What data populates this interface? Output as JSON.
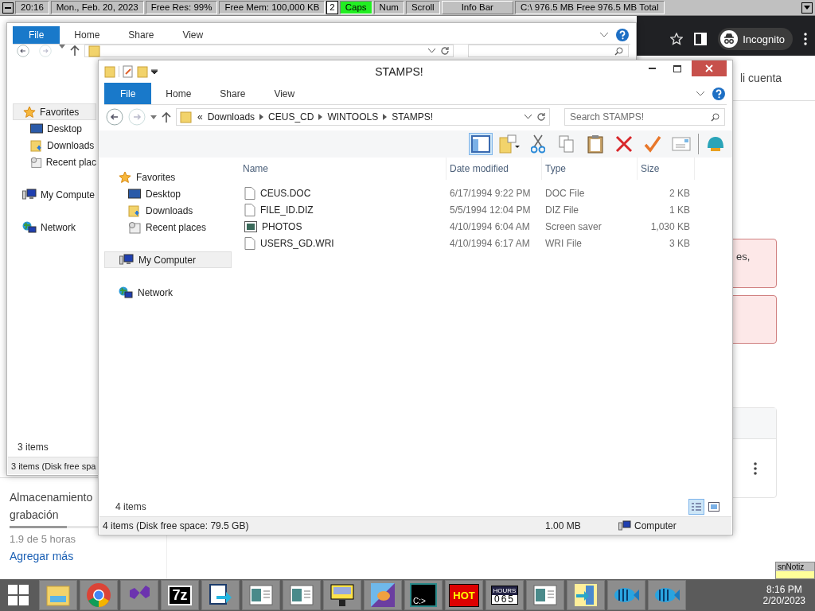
{
  "info_bar": {
    "items": [
      {
        "kind": "cell",
        "text": "20:16"
      },
      {
        "kind": "cell",
        "text": "Mon., Feb. 20, 2023"
      },
      {
        "kind": "cell",
        "text": "Free Res: 99%"
      },
      {
        "kind": "cell",
        "text": "Free Mem: 100,000 KB"
      },
      {
        "kind": "box",
        "text": "2"
      },
      {
        "kind": "toggle",
        "text": "Caps",
        "on": true
      },
      {
        "kind": "toggle",
        "text": "Num",
        "on": false
      },
      {
        "kind": "toggle",
        "text": "Scroll",
        "on": false
      },
      {
        "kind": "button",
        "text": "Info Bar"
      },
      {
        "kind": "cell",
        "text": "C:\\ 976.5 MB Free  976.5 MB Total"
      }
    ]
  },
  "browser": {
    "profile": "Incognito",
    "account_link": "li cuenta",
    "alert_text": "es,",
    "storage": {
      "title": "Almacenamiento",
      "subtitle": "grabación",
      "level": 0.38,
      "reading": "1.9 de 5 horas",
      "link": "Agregar más"
    }
  },
  "back_window": {
    "tabs": [
      {
        "label": "File",
        "selected": true
      },
      {
        "label": "Home",
        "selected": false
      },
      {
        "label": "Share",
        "selected": false
      },
      {
        "label": "View",
        "selected": false
      }
    ],
    "nav": [
      {
        "label": "Favorites",
        "kind": "favorites",
        "selected": true,
        "children": [
          {
            "label": "Desktop",
            "kind": "desktop",
            "selected": false
          },
          {
            "label": "Downloads",
            "kind": "downloads",
            "selected": false
          },
          {
            "label": "Recent plac",
            "kind": "recent",
            "selected": false
          }
        ]
      },
      {
        "label": "My Compute",
        "kind": "computer",
        "selected": false
      },
      {
        "label": "Network",
        "kind": "network",
        "selected": false
      }
    ],
    "item_count": "3 items",
    "status": "3 items (Disk free spa"
  },
  "window": {
    "title": "STAMPS!",
    "tabs": [
      {
        "label": "File",
        "selected": true
      },
      {
        "label": "Home",
        "selected": false
      },
      {
        "label": "Share",
        "selected": false
      },
      {
        "label": "View",
        "selected": false
      }
    ],
    "crumb_overflow": "«",
    "crumbs": [
      "Downloads",
      "CEUS_CD",
      "WINTOOLS",
      "STAMPS!"
    ],
    "search": {
      "placeholder": "Search STAMPS!"
    },
    "preview_pane_on": true,
    "nav": [
      {
        "label": "Favorites",
        "kind": "favorites",
        "selected": false,
        "children": [
          {
            "label": "Desktop",
            "kind": "desktop",
            "selected": false
          },
          {
            "label": "Downloads",
            "kind": "downloads",
            "selected": false
          },
          {
            "label": "Recent places",
            "kind": "recent",
            "selected": false
          }
        ]
      },
      {
        "label": "My Computer",
        "kind": "computer",
        "selected": true
      },
      {
        "label": "Network",
        "kind": "network",
        "selected": false
      }
    ],
    "columns": [
      "Name",
      "Date modified",
      "Type",
      "Size"
    ],
    "rows": [
      {
        "kind": "doc",
        "name": "CEUS.DOC",
        "date": "6/17/1994 9:22 PM",
        "type": "DOC File",
        "size": "2 KB"
      },
      {
        "kind": "doc",
        "name": "FILE_ID.DIZ",
        "date": "5/5/1994 12:04 PM",
        "type": "DIZ File",
        "size": "1 KB"
      },
      {
        "kind": "screensaver",
        "name": "PHOTOS",
        "date": "4/10/1994 6:04 AM",
        "type": "Screen saver",
        "size": "1,030 KB"
      },
      {
        "kind": "doc",
        "name": "USERS_GD.WRI",
        "date": "4/10/1994 6:17 AM",
        "type": "WRI File",
        "size": "3 KB"
      }
    ],
    "item_count": "4 items",
    "views": [
      {
        "kind": "details",
        "selected": true
      },
      {
        "kind": "tiles",
        "selected": false
      }
    ],
    "status": {
      "items": "4 items (Disk free space: 79.5 GB)",
      "size": "1.00 MB",
      "location": "Computer"
    }
  },
  "notes_widget": {
    "title": "snNotiz"
  },
  "taskbar": {
    "apps": [
      {
        "kind": "explorer"
      },
      {
        "kind": "chrome"
      },
      {
        "kind": "studio"
      },
      {
        "kind": "seven-zip",
        "label": "7z"
      },
      {
        "kind": "arrow"
      },
      {
        "kind": "window"
      },
      {
        "kind": "window"
      },
      {
        "kind": "disk"
      },
      {
        "kind": "hand"
      },
      {
        "kind": "terminal",
        "label": "C:>"
      },
      {
        "kind": "hot",
        "label": "HOT"
      },
      {
        "kind": "hours",
        "label": "HOURS",
        "reading": "065"
      },
      {
        "kind": "window"
      },
      {
        "kind": "door"
      },
      {
        "kind": "fish"
      },
      {
        "kind": "fish"
      }
    ],
    "clock": {
      "time": "8:16 PM",
      "date": "2/20/2023"
    }
  }
}
